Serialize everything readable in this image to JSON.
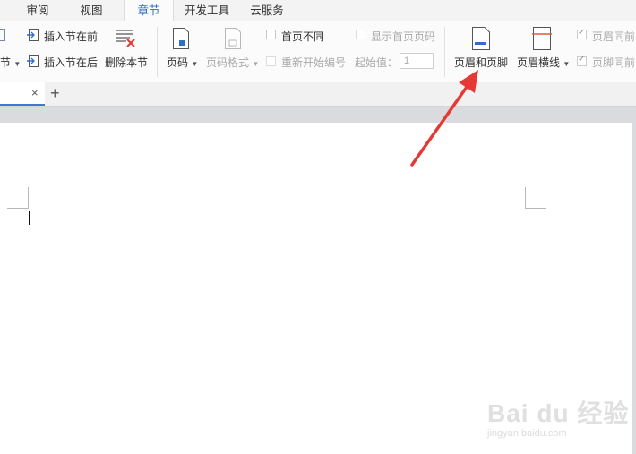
{
  "menu": {
    "tabs": [
      {
        "label": "审阅"
      },
      {
        "label": "视图"
      },
      {
        "label": "章节"
      },
      {
        "label": "开发工具"
      },
      {
        "label": "云服务"
      }
    ]
  },
  "ribbon": {
    "section_partial": "节",
    "insert_before": "插入节在前",
    "insert_after": "插入节后",
    "insert_after_full": "插入节在后",
    "delete_section": "删除本节",
    "page_number": "页码",
    "page_number_format": "页码格式",
    "first_page_different": "首页不同",
    "show_first_page_number": "显示首页页码",
    "restart_numbering": "重新开始编号",
    "start_value_label": "起始值：",
    "start_value": "1",
    "header_footer": "页眉和页脚",
    "header_line": "页眉横线",
    "same_header_prev": "页眉同前",
    "same_footer_prev": "页脚同前"
  },
  "watermark": {
    "main": "Bai du 经验",
    "sub": "jingyan.baidu.com"
  },
  "colors": {
    "accent": "#2f6dc8",
    "arrow": "#e53935"
  }
}
